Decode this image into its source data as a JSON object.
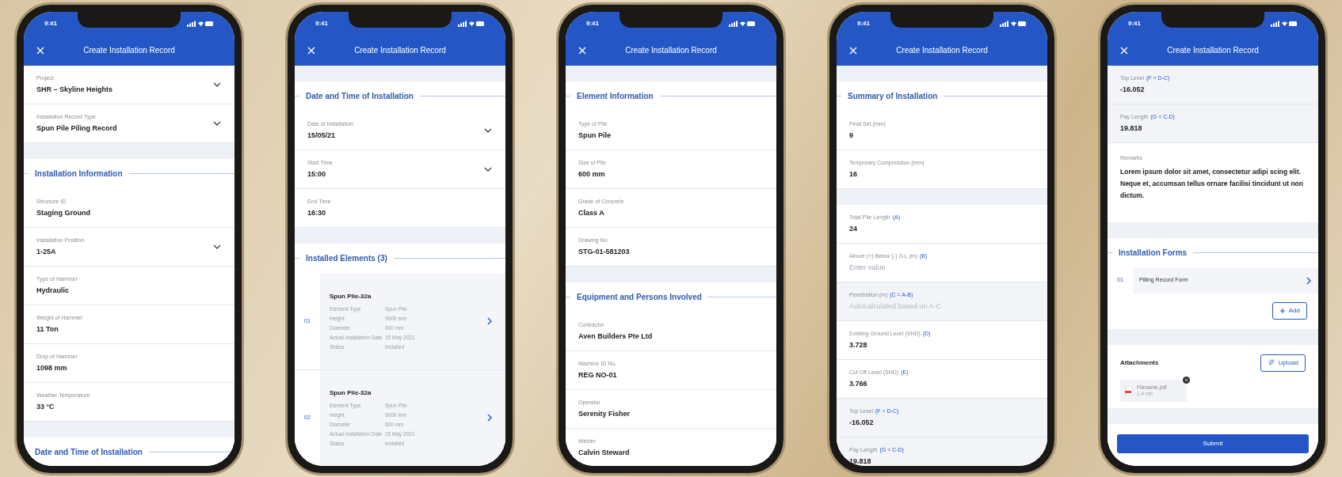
{
  "phones": [
    {
      "time": "9:41",
      "title": "Create Installation Record",
      "blocks": [
        {
          "kind": "field",
          "label": "Project",
          "value": "SHR – Skyline Heights",
          "dropdown": true,
          "disabled": false
        },
        {
          "kind": "field",
          "label": "Installation Record Type",
          "value": "Spun Pile Piling Record",
          "dropdown": true,
          "disabled": false
        },
        {
          "kind": "gap"
        },
        {
          "kind": "heading",
          "text": "Installation Information"
        },
        {
          "kind": "field",
          "label": "Structure ID",
          "value": "Staging Ground",
          "dropdown": false,
          "disabled": false
        },
        {
          "kind": "field",
          "label": "Installation Position",
          "value": "1-25A",
          "dropdown": true,
          "disabled": false
        },
        {
          "kind": "field",
          "label": "Type of Hammer",
          "value": "Hydraulic",
          "dropdown": false,
          "disabled": false
        },
        {
          "kind": "field",
          "label": "Weight of Hammer",
          "value": "11 Ton",
          "dropdown": false,
          "disabled": false
        },
        {
          "kind": "field",
          "label": "Drop of Hammer",
          "value": "1098 mm",
          "dropdown": false,
          "disabled": false
        },
        {
          "kind": "field",
          "label": "Weather Temperature",
          "value": "33 °C",
          "dropdown": false,
          "disabled": false
        },
        {
          "kind": "gap"
        },
        {
          "kind": "heading",
          "text": "Date and Time of Installation"
        }
      ]
    },
    {
      "time": "9:41",
      "title": "Create Installation Record",
      "blocks": [
        {
          "kind": "gap"
        },
        {
          "kind": "heading",
          "text": "Date and Time of Installation"
        },
        {
          "kind": "field",
          "label": "Date of Installation",
          "value": "15/05/21",
          "dropdown": true,
          "disabled": false
        },
        {
          "kind": "field",
          "label": "Start Time",
          "value": "15:00",
          "dropdown": true,
          "disabled": false
        },
        {
          "kind": "field",
          "label": "End Time",
          "value": "16:30",
          "dropdown": false,
          "disabled": false
        },
        {
          "kind": "gap"
        },
        {
          "kind": "heading",
          "text": "Installed Elements (3)"
        },
        {
          "kind": "element",
          "index": "01",
          "name": "Spun Pile-32a",
          "details": [
            {
              "label": "Element Type",
              "value": "Spun Pile"
            },
            {
              "label": "Height",
              "value": "9000 mm"
            },
            {
              "label": "Diameter",
              "value": "600 mm"
            },
            {
              "label": "Actual Installation Date",
              "value": "15 May 2021"
            },
            {
              "label": "Status",
              "value": "Installed"
            }
          ]
        },
        {
          "kind": "element",
          "index": "02",
          "name": "Spun Pile-32a",
          "details": [
            {
              "label": "Element Type",
              "value": "Spun Pile"
            },
            {
              "label": "Height",
              "value": "9000 mm"
            },
            {
              "label": "Diameter",
              "value": "600 mm"
            },
            {
              "label": "Actual Installation Date",
              "value": "15 May 2021"
            },
            {
              "label": "Status",
              "value": "Installed"
            }
          ]
        }
      ]
    },
    {
      "time": "9:41",
      "title": "Create Installation Record",
      "blocks": [
        {
          "kind": "gap"
        },
        {
          "kind": "heading",
          "text": "Element Information"
        },
        {
          "kind": "field",
          "label": "Type of Pile",
          "value": "Spun Pile",
          "dropdown": false,
          "disabled": false
        },
        {
          "kind": "field",
          "label": "Size of Pile",
          "value": "600 mm",
          "dropdown": false,
          "disabled": false
        },
        {
          "kind": "field",
          "label": "Grade of Concrete",
          "value": "Class A",
          "dropdown": false,
          "disabled": false
        },
        {
          "kind": "field",
          "label": "Drawing No.",
          "value": "STG-01-581203",
          "dropdown": false,
          "disabled": false
        },
        {
          "kind": "gap"
        },
        {
          "kind": "heading",
          "text": "Equipment and Persons Involved"
        },
        {
          "kind": "field",
          "label": "Contractor",
          "value": "Aven Builders Pte Ltd",
          "dropdown": false,
          "disabled": false
        },
        {
          "kind": "field",
          "label": "Machine ID No.",
          "value": "REG NO-01",
          "dropdown": false,
          "disabled": false
        },
        {
          "kind": "field",
          "label": "Operator",
          "value": "Serenity Fisher",
          "dropdown": false,
          "disabled": false
        },
        {
          "kind": "field",
          "label": "Welder",
          "value": "Calvin Steward",
          "dropdown": false,
          "disabled": false
        }
      ]
    },
    {
      "time": "9:41",
      "title": "Create Installation Record",
      "blocks": [
        {
          "kind": "gap"
        },
        {
          "kind": "heading",
          "text": "Summary of Installation"
        },
        {
          "kind": "field",
          "label": "Final Set (mm)",
          "value": "9",
          "dropdown": false,
          "disabled": false
        },
        {
          "kind": "field",
          "label": "Temporary Compression (mm)",
          "value": "16",
          "dropdown": false,
          "disabled": false
        },
        {
          "kind": "gap"
        },
        {
          "kind": "field",
          "label": "Total Pile Length",
          "formula": "(A)",
          "value": "24",
          "dropdown": false,
          "disabled": false
        },
        {
          "kind": "field",
          "label": "Above (+) Below (-) G.L (m)",
          "formula": "(B)",
          "placeholder": "Enter value",
          "dropdown": false,
          "disabled": false
        },
        {
          "kind": "field",
          "label": "Penetration (m)",
          "formula": "(C = A-B)",
          "placeholder": "Autocalculated based on A-C",
          "dropdown": false,
          "disabled": true
        },
        {
          "kind": "field",
          "label": "Existing Ground Level (SHD)",
          "formula": "(D)",
          "value": "3.728",
          "dropdown": false,
          "disabled": false
        },
        {
          "kind": "field",
          "label": "Cut Off Level (SHD)",
          "formula": "(E)",
          "value": "3.766",
          "dropdown": false,
          "disabled": false
        },
        {
          "kind": "field",
          "label": "Top Level",
          "formula": "(F = D-C)",
          "value": "-16.052",
          "dropdown": false,
          "disabled": true
        },
        {
          "kind": "field",
          "label": "Pay Length",
          "formula": "(G = C-D)",
          "value": "19.818",
          "dropdown": false,
          "disabled": true
        }
      ]
    },
    {
      "time": "9:41",
      "title": "Create Installation Record",
      "blocks": [
        {
          "kind": "field",
          "label": "Top Level",
          "formula": "(F = D-C)",
          "value": "-16.052",
          "dropdown": false,
          "disabled": true
        },
        {
          "kind": "field",
          "label": "Pay Length",
          "formula": "(G = C-D)",
          "value": "19.818",
          "dropdown": false,
          "disabled": true
        },
        {
          "kind": "remarks",
          "label": "Remarks",
          "value": "Lorem ipsum dolor sit amet, consectetur adipi scing elit. Neque et, accumsan tellus ornare facilisi tincidunt ut non dictum."
        },
        {
          "kind": "gap"
        },
        {
          "kind": "heading",
          "text": "Installation Forms"
        },
        {
          "kind": "form",
          "index": "01",
          "name": "Pilling Record Form"
        },
        {
          "kind": "add",
          "label": "Add"
        },
        {
          "kind": "gap"
        },
        {
          "kind": "attachments",
          "title": "Attachments",
          "button": "Upload",
          "file": {
            "name": "Filename.pdf",
            "size": "1.4 mb"
          }
        },
        {
          "kind": "gap"
        },
        {
          "kind": "submit",
          "label": "Submit"
        }
      ]
    }
  ]
}
